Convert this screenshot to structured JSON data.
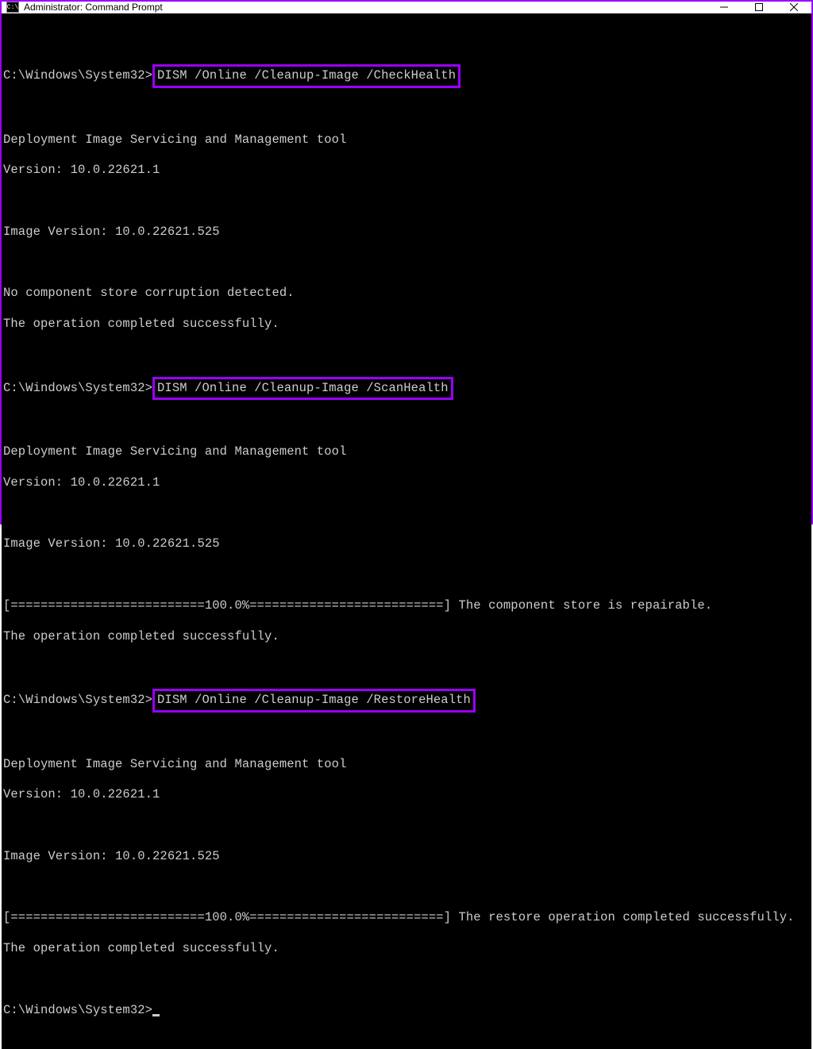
{
  "window": {
    "title": "Administrator: Command Prompt",
    "icon_label": "C:\\"
  },
  "highlight_color": "#9a00ff",
  "prompt": "C:\\Windows\\System32>",
  "commands": {
    "check": "DISM /Online /Cleanup-Image /CheckHealth",
    "scan": "DISM /Online /Cleanup-Image /ScanHealth",
    "restore": "DISM /Online /Cleanup-Image /RestoreHealth"
  },
  "output": {
    "tool_header": "Deployment Image Servicing and Management tool",
    "tool_version": "Version: 10.0.22621.1",
    "image_version": "Image Version: 10.0.22621.525",
    "check_result": "No component store corruption detected.",
    "completed": "The operation completed successfully.",
    "progress_bar": "[==========================100.0%==========================] ",
    "scan_result_tail": "The component store is repairable.",
    "restore_result_tail": "The restore operation completed successfully."
  }
}
